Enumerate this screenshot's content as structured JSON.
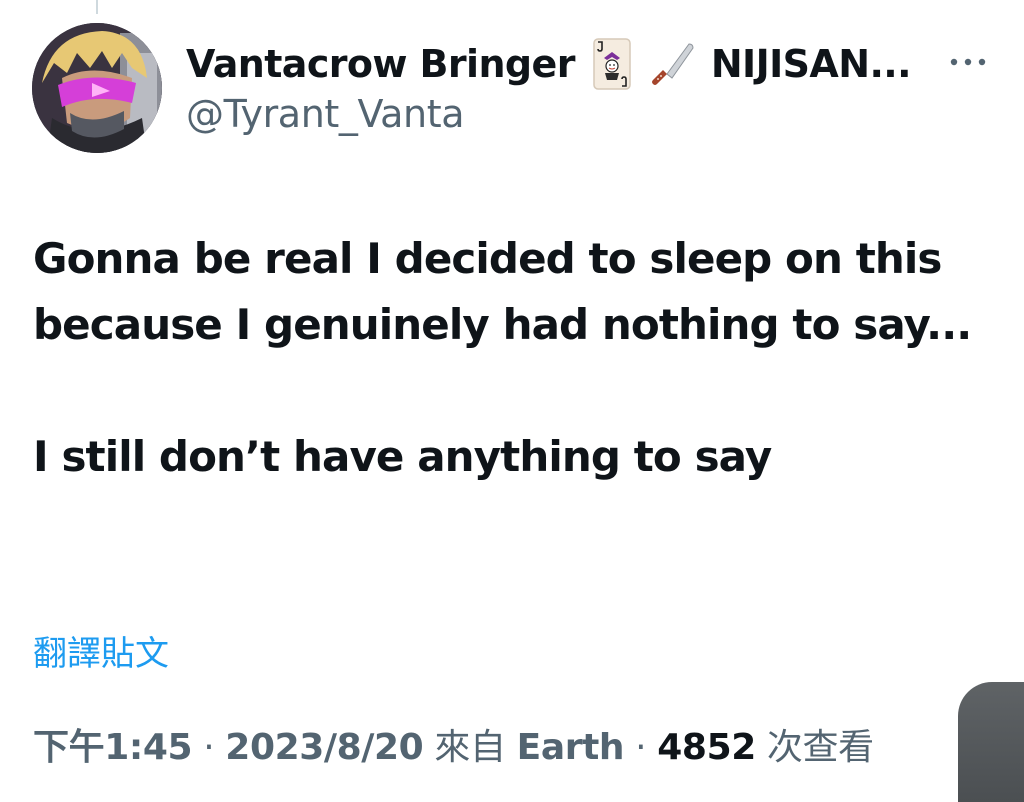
{
  "author": {
    "display_name": "Vantacrow Bringer",
    "name_tail": "NIJISAN...",
    "name_emojis": [
      "joker-card-icon",
      "kitchen-knife-icon"
    ],
    "handle": "@Tyrant_Vanta"
  },
  "tweet": {
    "paragraphs": [
      "Gonna be real I decided to sleep on this because I genuinely had nothing to say...",
      "I still don’t have anything to say"
    ]
  },
  "translate_label": "翻譯貼文",
  "meta": {
    "time": "下午1:45",
    "separator": "·",
    "date": "2023/8/20",
    "source_prefix": "來自",
    "source": "Earth",
    "views_count": "4852",
    "views_label": "次查看"
  },
  "colors": {
    "text_primary": "#0f1419",
    "text_secondary": "#536471",
    "link": "#1d9bf0"
  }
}
